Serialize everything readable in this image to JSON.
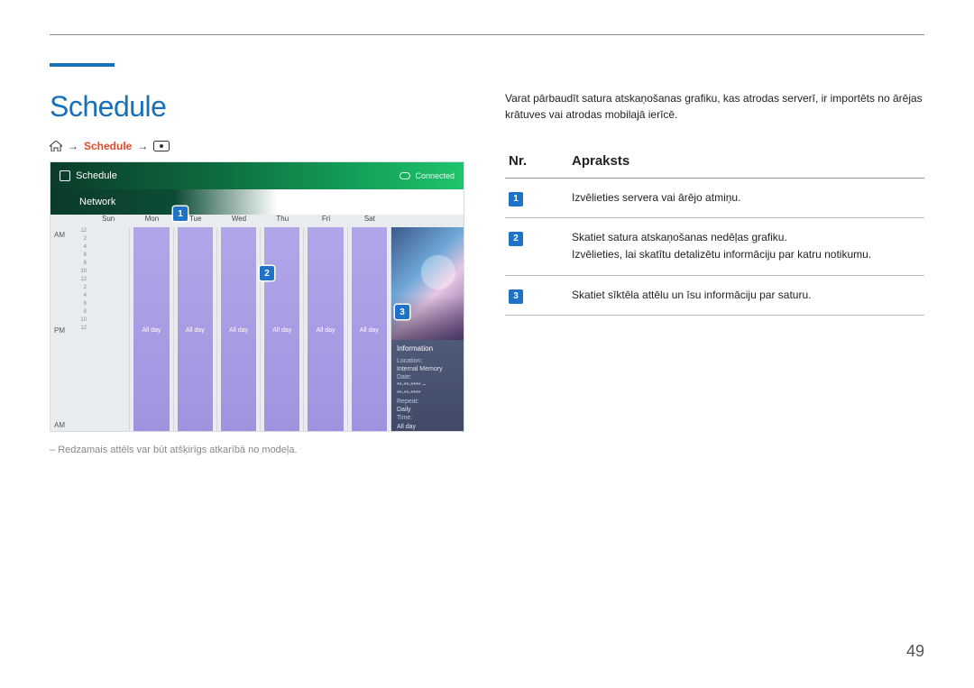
{
  "page": {
    "number": "49"
  },
  "heading": "Schedule",
  "breadcrumb": {
    "schedule": "Schedule"
  },
  "screenshot": {
    "title": "Schedule",
    "connected": "Connected",
    "network": "Network",
    "days": [
      "Sun",
      "Mon",
      "Tue",
      "Wed",
      "Thu",
      "Fri",
      "Sat"
    ],
    "am": "AM",
    "pm": "PM",
    "ticks": [
      "12",
      "2",
      "4",
      "6",
      "8",
      "10",
      "12",
      "2",
      "4",
      "6",
      "8",
      "10",
      "12"
    ],
    "bar_label": "All day",
    "info": {
      "header": "Information",
      "loc_lbl": "Location:",
      "loc_val": "Internal Memory",
      "date_lbl": "Date:",
      "date_val": "**-**-**** ~",
      "date_val2": "**-**-****",
      "repeat_lbl": "Repeat:",
      "repeat_val": "Daily",
      "time_lbl": "Time:",
      "time_val": "All day"
    },
    "callouts": {
      "c1": "1",
      "c2": "2",
      "c3": "3"
    }
  },
  "footnote": "Redzamais attēls var būt atšķirīgs atkarībā no modeļa.",
  "intro": "Varat pārbaudīt satura atskaņošanas grafiku, kas atrodas serverī, ir importēts no ārējas krātuves vai atrodas mobilajā ierīcē.",
  "table": {
    "h1": "Nr.",
    "h2": "Apraksts",
    "rows": [
      {
        "n": "1",
        "lines": [
          "Izvēlieties servera vai ārējo atmiņu."
        ]
      },
      {
        "n": "2",
        "lines": [
          "Skatiet satura atskaņošanas nedēļas grafiku.",
          "Izvēlieties, lai skatītu detalizētu informāciju par katru notikumu."
        ]
      },
      {
        "n": "3",
        "lines": [
          "Skatiet sīktēla attēlu un īsu informāciju par saturu."
        ]
      }
    ]
  }
}
